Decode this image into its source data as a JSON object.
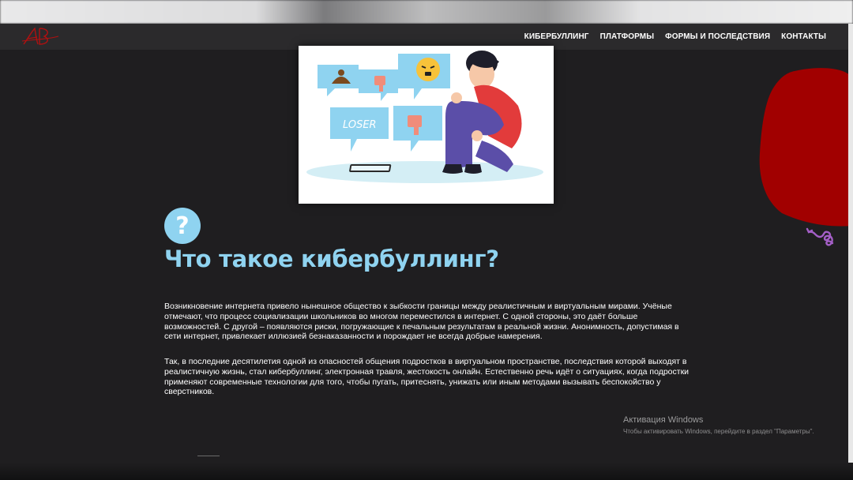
{
  "nav": {
    "logo_text": "АВ",
    "links": [
      {
        "label": "КИБЕРБУЛЛИНГ"
      },
      {
        "label": "ПЛАТФОРМЫ"
      },
      {
        "label": "ФОРМЫ И ПОСЛЕДСТВИЯ"
      },
      {
        "label": "КОНТАКТЫ"
      }
    ]
  },
  "hero": {
    "bubble_text": "LOSER"
  },
  "section": {
    "icon_glyph": "?",
    "title": "Что такое кибербуллинг?",
    "paragraphs": [
      "Возникновение интернета привело нынешное общество к зыбкости границы между реалистичным и виртуальным мирами. Учёные отмечают, что процесс социализации школьников во многом переместился в интернет. С одной стороны, это даёт больше возможностей. С другой – появляются риски, погружающие к печальным результатам в реальной жизни. Анонимность, допустимая в сети интернет, привлекает иллюзией безнаказанности и порождает не всегда добрые намерения.",
      "Так, в последние десятилетия одной из опасностей общения подростков в виртуальном пространстве, последствия которой выходят в реалистичную жизнь, стал кибербуллинг, электронная травля, жестокость онлайн. Естественно речь идёт о ситуациях, когда подростки применяют современные технологии для того, чтобы пугать, притеснять, унижать или иным методами вызывать беспокойство у сверстников."
    ]
  },
  "windows_activation": {
    "title": "Активация Windows",
    "subtitle": "Чтобы активировать Windows, перейдите в раздел \"Параметры\"."
  },
  "colors": {
    "background": "#1f1e20",
    "navbar": "#2b2a2c",
    "accent_blue": "#8fd3f0",
    "red_blob": "#a10000",
    "squiggle": "#a45fc7"
  },
  "icons": [
    "logo-icon",
    "question-icon",
    "squiggle-arrow-icon"
  ]
}
